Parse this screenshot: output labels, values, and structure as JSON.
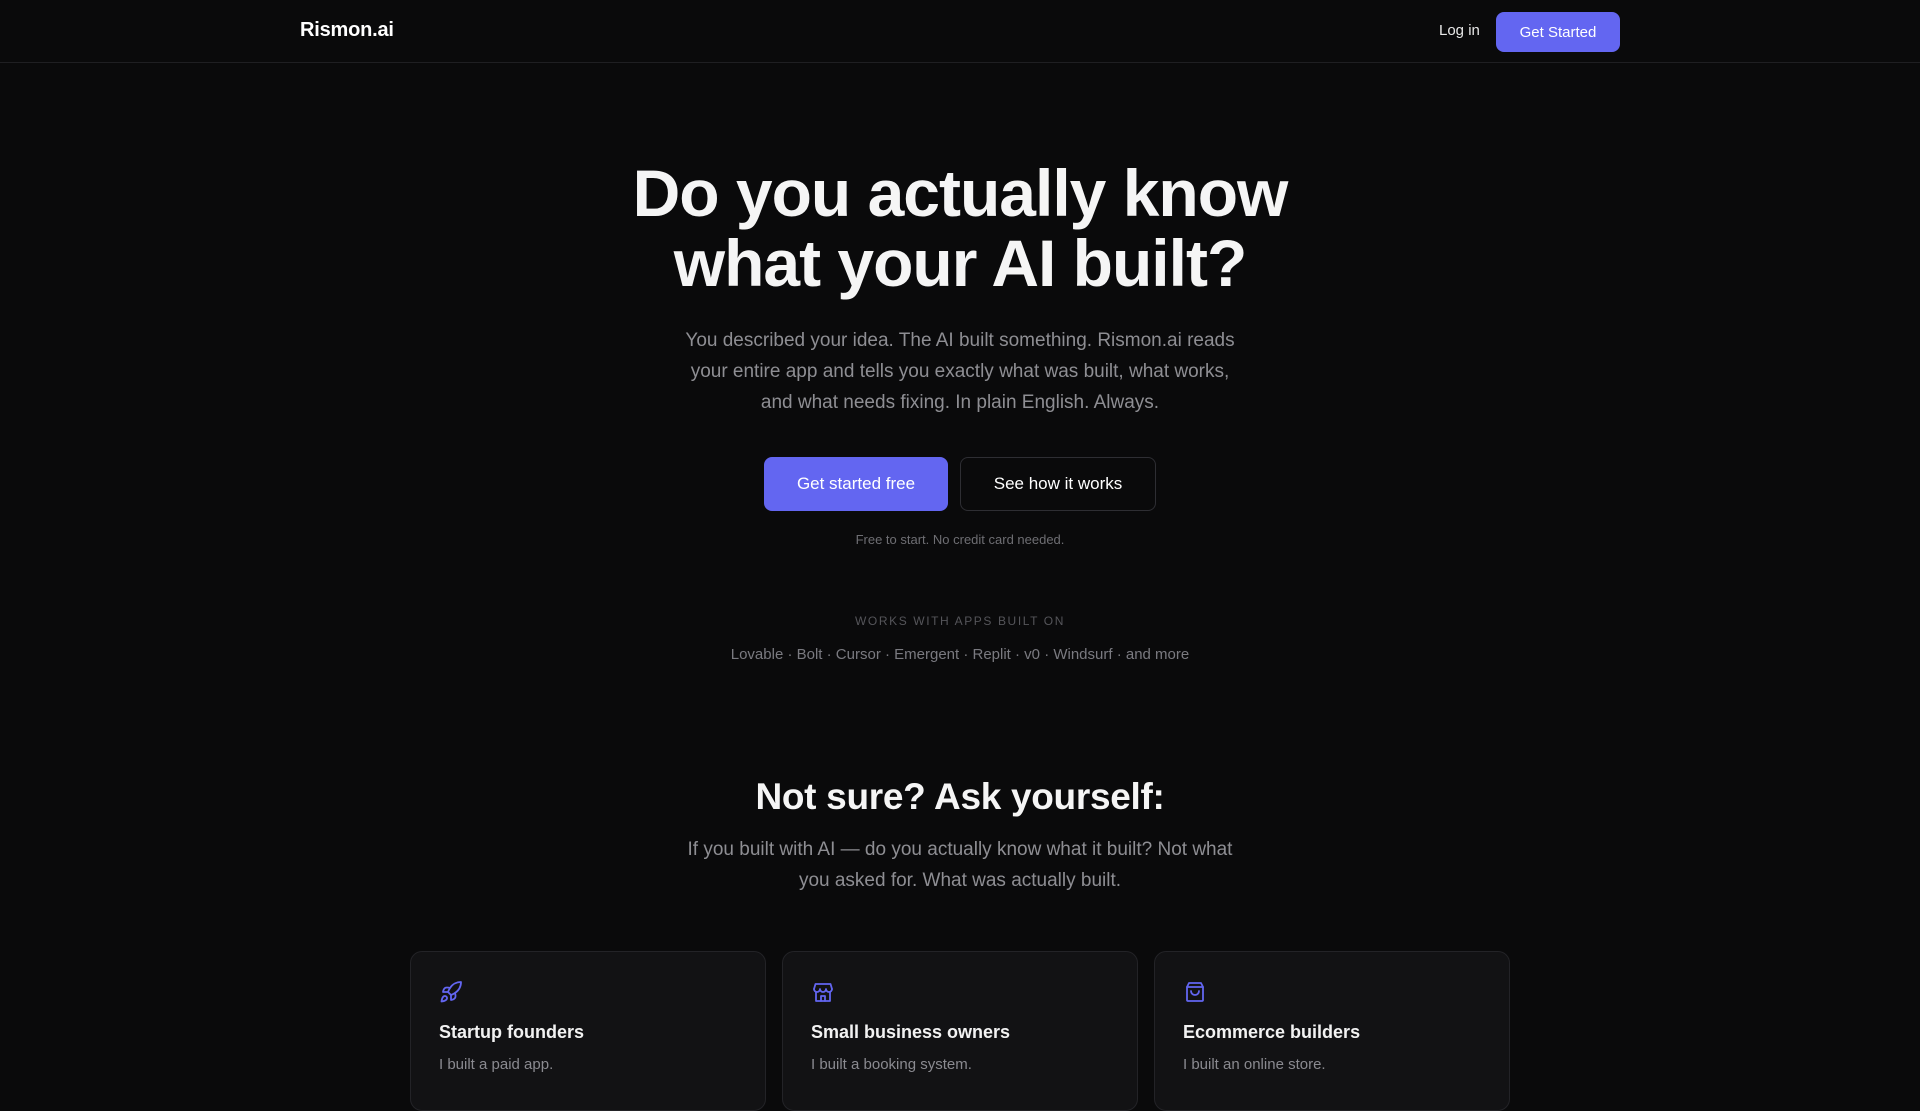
{
  "nav": {
    "logo": "Rismon.ai",
    "login_label": "Log in",
    "cta_label": "Get Started"
  },
  "hero": {
    "title_line1": "Do you actually know",
    "title_line2": "what your AI built?",
    "subtitle_line1": "You described your idea. The AI built something. Rismon.ai reads",
    "subtitle_line2": "your entire app and tells you exactly what was built, what works,",
    "subtitle_line3": "and what needs fixing. In plain English. Always.",
    "primary_button": "Get started free",
    "secondary_button": "See how it works",
    "fine_print": "Free to start. No credit card needed."
  },
  "works_with": {
    "label": "WORKS WITH APPS BUILT ON",
    "list": "Lovable · Bolt · Cursor · Emergent · Replit · v0 · Windsurf · and more"
  },
  "section": {
    "title": "Not sure? Ask yourself:",
    "subtitle_line1": "If you built with AI — do you actually know what it built? Not what",
    "subtitle_line2": "you asked for. What was actually built."
  },
  "cards": [
    {
      "icon": "rocket-icon",
      "title": "Startup founders",
      "description": "I built a paid app."
    },
    {
      "icon": "store-icon",
      "title": "Small business owners",
      "description": "I built a booking system."
    },
    {
      "icon": "shopping-bag-icon",
      "title": "Ecommerce builders",
      "description": "I built an online store."
    }
  ],
  "colors": {
    "accent": "#6366f1",
    "background": "#0a0a0b",
    "card_background": "#121214"
  }
}
